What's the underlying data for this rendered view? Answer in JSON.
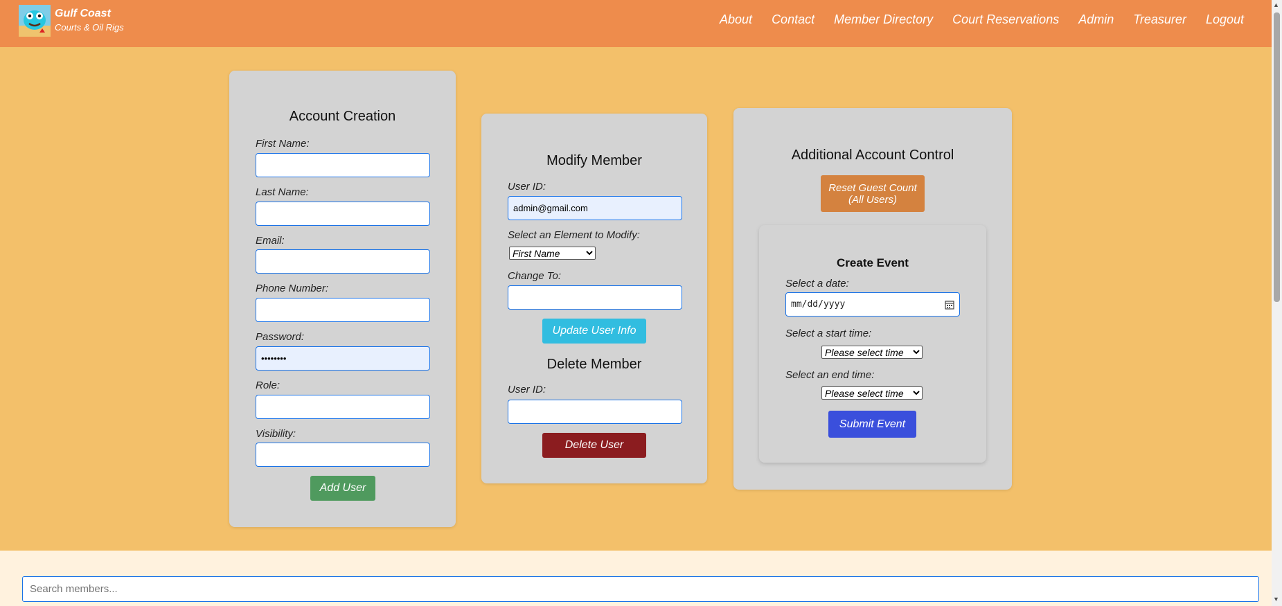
{
  "brand": {
    "title": "Gulf Coast",
    "subtitle": "Courts & Oil Rigs"
  },
  "nav": [
    "About",
    "Contact",
    "Member Directory",
    "Court Reservations",
    "Admin",
    "Treasurer",
    "Logout"
  ],
  "account_creation": {
    "title": "Account Creation",
    "first_name_label": "First Name:",
    "last_name_label": "Last Name:",
    "email_label": "Email:",
    "phone_label": "Phone Number:",
    "password_label": "Password:",
    "password_value": "••••••••",
    "role_label": "Role:",
    "visibility_label": "Visibility:",
    "add_button": "Add User"
  },
  "modify_member": {
    "title": "Modify Member",
    "user_id_label": "User ID:",
    "user_id_value": "admin@gmail.com",
    "element_label": "Select an Element to Modify:",
    "element_selected": "First Name",
    "change_to_label": "Change To:",
    "update_button": "Update User Info"
  },
  "delete_member": {
    "title": "Delete Member",
    "user_id_label": "User ID:",
    "delete_button": "Delete User"
  },
  "additional_control": {
    "title": "Additional Account Control",
    "reset_button": "Reset Guest Count (All Users)"
  },
  "create_event": {
    "title": "Create Event",
    "date_label": "Select a date:",
    "date_placeholder": "mm/dd/yyyy",
    "start_label": "Select a start time:",
    "start_selected": "Please select time",
    "end_label": "Select an end time:",
    "end_selected": "Please select time",
    "submit_button": "Submit Event"
  },
  "search": {
    "placeholder": "Search members..."
  },
  "colors": {
    "nav_bg": "#ee8c4c",
    "page_bg": "#f3c06a",
    "card_bg": "#d3d3d3",
    "add_button": "#4f9a5e",
    "update_button": "#31bde0",
    "delete_button": "#8b1c1f",
    "reset_button": "#d4823f",
    "submit_button": "#3a4fdc"
  }
}
